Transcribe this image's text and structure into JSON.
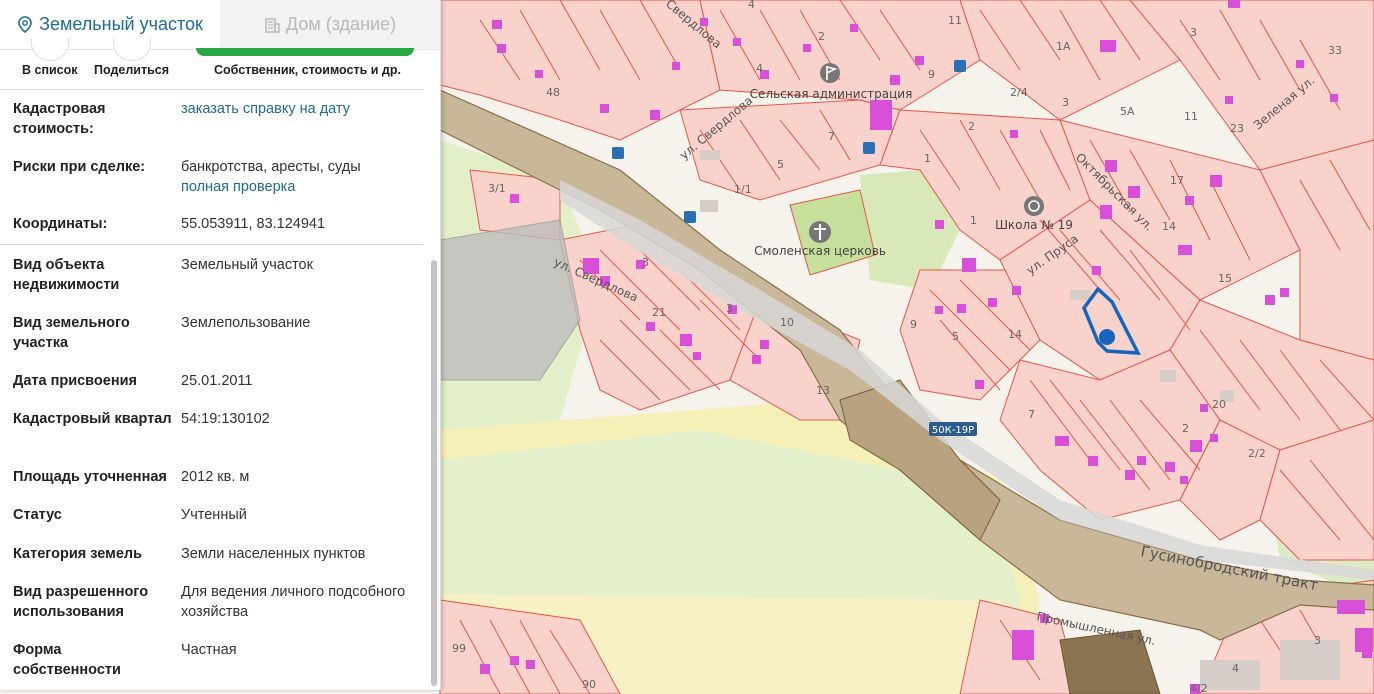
{
  "tabs": [
    {
      "label": "Земельный участок",
      "active": true,
      "icon": "location-pin-icon"
    },
    {
      "label": "Дом (здание)",
      "active": false,
      "icon": "building-icon"
    }
  ],
  "actions": {
    "to_list": "В список",
    "share": "Поделиться",
    "owner": "Собственник, стоимость и др."
  },
  "fields": [
    {
      "key": "Кадастровая стоимость:",
      "value": "",
      "link": "заказать справку на дату"
    },
    {
      "key": "Риски при сделке:",
      "value": "банкротства, аресты, суды",
      "link": "полная проверка"
    },
    {
      "key": "Координаты:",
      "value": "55.053911, 83.124941",
      "link": ""
    },
    {
      "key": "Вид объекта недвижимости",
      "value": "Земельный участок",
      "link": ""
    },
    {
      "key": "Вид земельного участка",
      "value": "Землепользование",
      "link": ""
    },
    {
      "key": "Дата присвоения",
      "value": "25.01.2011",
      "link": ""
    },
    {
      "key": "Кадастровый квартал",
      "value": "54:19:130102",
      "link": ""
    },
    {
      "key": "Площадь уточненная",
      "value": "2012 кв. м",
      "link": ""
    },
    {
      "key": "Статус",
      "value": "Учтенный",
      "link": ""
    },
    {
      "key": "Категория земель",
      "value": "Земли населенных пунктов",
      "link": ""
    },
    {
      "key": "Вид разрешенного использования",
      "value": "Для ведения личного подсобного хозяйства",
      "link": ""
    },
    {
      "key": "Форма собственности",
      "value": "Частная",
      "link": ""
    }
  ],
  "map": {
    "streets": {
      "sverdlova_1": "ул. Свердлова",
      "sverdlova_2": "ул. Свердлова",
      "sverdlova_3": "Свердлова",
      "oktyabrskaya": "Октябрьская ул.",
      "prusa": "ул. Пруса",
      "zelenaya": "Зеленая ул.",
      "gusinobrodsky": "Гусинобродский тракт",
      "promyshlennaya": "Промышленная ул."
    },
    "poi": {
      "admin": "Сельская администрация",
      "church": "Смоленская церковь",
      "school": "Школа № 19"
    },
    "road_badge": "50К-19Р",
    "house_numbers": [
      "4",
      "3",
      "11",
      "1А",
      "4",
      "33",
      "48",
      "2",
      "9",
      "2/4",
      "3",
      "5А",
      "11",
      "23",
      "2",
      "1",
      "17",
      "1/1",
      "5",
      "7",
      "1",
      "14",
      "3/1",
      "3",
      "15",
      "21",
      "10",
      "3",
      "13",
      "9",
      "5",
      "14",
      "7",
      "20",
      "2",
      "2/2",
      "99",
      "90",
      "4",
      "4/2",
      "3"
    ]
  },
  "colors": {
    "accent": "#1e6b9a",
    "parcel_fill": "#f9d3cb",
    "parcel_stroke": "#e8574a",
    "building": "#d94fd8",
    "road_brown": "#a08a6c",
    "selected": "#1565c0",
    "green_button": "#27a844"
  }
}
